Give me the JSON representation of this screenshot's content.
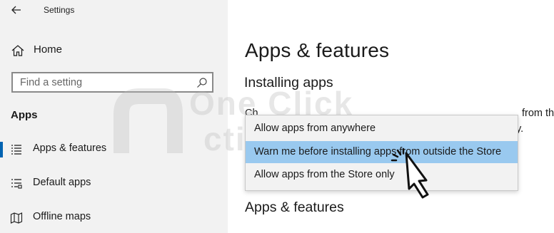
{
  "window": {
    "title": "Settings"
  },
  "sidebar": {
    "home_label": "Home",
    "search": {
      "placeholder": "Find a setting"
    },
    "section_heading": "Apps",
    "items": [
      {
        "label": "Apps & features",
        "icon": "apps-features-icon",
        "active": true
      },
      {
        "label": "Default apps",
        "icon": "default-apps-icon",
        "active": false
      },
      {
        "label": "Offline maps",
        "icon": "offline-maps-icon",
        "active": false
      }
    ]
  },
  "main": {
    "page_title": "Apps & features",
    "installing_heading": "Installing apps",
    "desc_start": "Ch",
    "desc_end": "from the",
    "desc_line2_end": "y.",
    "apps_features_heading": "Apps & features"
  },
  "dropdown": {
    "options": [
      {
        "label": "Allow apps from anywhere",
        "selected": false
      },
      {
        "label": "Warn me before installing apps from outside the Store",
        "selected": true
      },
      {
        "label": "Allow apps from the Store only",
        "selected": false
      }
    ]
  },
  "watermark": {
    "line1": "One Click",
    "line2": "ctivate"
  },
  "colors": {
    "sidebar_bg": "#f2f2f2",
    "accent": "#0063b1",
    "selected_option": "#99c9ef",
    "dropdown_bg": "#f2f2f2"
  }
}
